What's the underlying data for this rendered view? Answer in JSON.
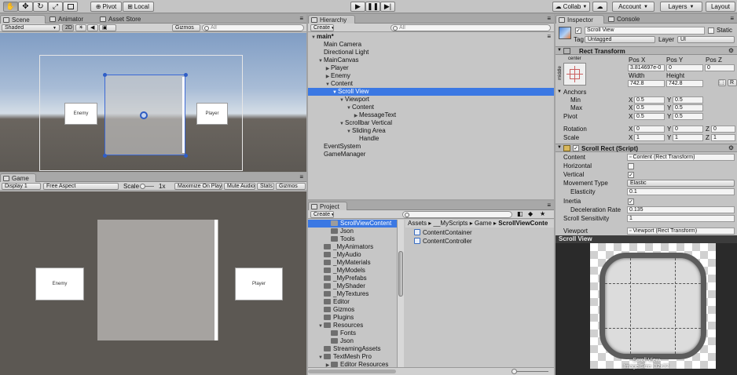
{
  "toolbar": {
    "pivot_label": "Pivot",
    "local_label": "Local",
    "collab_label": "Collab",
    "account_label": "Account",
    "layers_label": "Layers",
    "layout_label": "Layout"
  },
  "scene": {
    "tabs": [
      "Scene",
      "Animator",
      "Asset Store"
    ],
    "shading_label": "Shaded",
    "mode_2d_label": "2D",
    "gizmos_label": "Gizmos",
    "search_placeholder": "All",
    "card_left": "Enemy",
    "card_right": "Player"
  },
  "game": {
    "tab_label": "Game",
    "display_label": "Display 1",
    "aspect_label": "Free Aspect",
    "scale_label": "Scale",
    "scale_value": "1x",
    "maximize_label": "Maximize On Play",
    "mute_label": "Mute Audio",
    "stats_label": "Stats",
    "gizmos_label": "Gizmos",
    "card_left": "Enemy",
    "card_right": "Player"
  },
  "hierarchy": {
    "tab_label": "Hierarchy",
    "create_label": "Create",
    "search_placeholder": "All",
    "items": [
      {
        "label": "main*",
        "depth": 0,
        "expander": "down",
        "selected": false
      },
      {
        "label": "Main Camera",
        "depth": 1,
        "expander": "",
        "selected": false
      },
      {
        "label": "Directional Light",
        "depth": 1,
        "expander": "",
        "selected": false
      },
      {
        "label": "MainCanvas",
        "depth": 1,
        "expander": "down",
        "selected": false
      },
      {
        "label": "Player",
        "depth": 2,
        "expander": "right",
        "selected": false
      },
      {
        "label": "Enemy",
        "depth": 2,
        "expander": "right",
        "selected": false
      },
      {
        "label": "Content",
        "depth": 2,
        "expander": "down",
        "selected": false
      },
      {
        "label": "Scroll View",
        "depth": 3,
        "expander": "down",
        "selected": true
      },
      {
        "label": "Viewport",
        "depth": 4,
        "expander": "down",
        "selected": false
      },
      {
        "label": "Content",
        "depth": 5,
        "expander": "down",
        "selected": false
      },
      {
        "label": "MessageText",
        "depth": 6,
        "expander": "right",
        "selected": false
      },
      {
        "label": "Scrollbar Vertical",
        "depth": 4,
        "expander": "down",
        "selected": false
      },
      {
        "label": "Sliding Area",
        "depth": 5,
        "expander": "down",
        "selected": false
      },
      {
        "label": "Handle",
        "depth": 6,
        "expander": "",
        "selected": false
      },
      {
        "label": "EventSystem",
        "depth": 1,
        "expander": "",
        "selected": false
      },
      {
        "label": "GameManager",
        "depth": 1,
        "expander": "",
        "selected": false
      }
    ]
  },
  "project": {
    "tab_label": "Project",
    "create_label": "Create",
    "breadcrumb": [
      "Assets",
      "__MyScripts",
      "Game",
      "ScrollViewConte"
    ],
    "tree": [
      {
        "label": "ScrollViewContent",
        "depth": 2,
        "expander": "",
        "selected": true
      },
      {
        "label": "Json",
        "depth": 2,
        "expander": "",
        "selected": false
      },
      {
        "label": "Tools",
        "depth": 2,
        "expander": "",
        "selected": false
      },
      {
        "label": "_MyAnimators",
        "depth": 1,
        "expander": "",
        "selected": false
      },
      {
        "label": "_MyAudio",
        "depth": 1,
        "expander": "",
        "selected": false
      },
      {
        "label": "_MyMaterials",
        "depth": 1,
        "expander": "",
        "selected": false
      },
      {
        "label": "_MyModels",
        "depth": 1,
        "expander": "",
        "selected": false
      },
      {
        "label": "_MyPrefabs",
        "depth": 1,
        "expander": "",
        "selected": false
      },
      {
        "label": "_MyShader",
        "depth": 1,
        "expander": "",
        "selected": false
      },
      {
        "label": "_MyTextures",
        "depth": 1,
        "expander": "",
        "selected": false
      },
      {
        "label": "Editor",
        "depth": 1,
        "expander": "",
        "selected": false
      },
      {
        "label": "Gizmos",
        "depth": 1,
        "expander": "",
        "selected": false
      },
      {
        "label": "Plugins",
        "depth": 1,
        "expander": "",
        "selected": false
      },
      {
        "label": "Resources",
        "depth": 1,
        "expander": "down",
        "selected": false
      },
      {
        "label": "Fonts",
        "depth": 2,
        "expander": "",
        "selected": false
      },
      {
        "label": "Json",
        "depth": 2,
        "expander": "",
        "selected": false
      },
      {
        "label": "StreamingAssets",
        "depth": 1,
        "expander": "",
        "selected": false
      },
      {
        "label": "TextMesh Pro",
        "depth": 1,
        "expander": "down",
        "selected": false
      },
      {
        "label": "Editor Resources",
        "depth": 2,
        "expander": "right",
        "selected": false
      }
    ],
    "files": [
      "ContentContainer",
      "ContentController"
    ]
  },
  "inspector": {
    "tabs": [
      "Inspector",
      "Console"
    ],
    "object_name": "Scroll View",
    "static_label": "Static",
    "tag_label": "Tag",
    "tag_value": "Untagged",
    "layer_label": "Layer",
    "layer_value": "UI",
    "rect_transform": {
      "title": "Rect Transform",
      "anchor_h": "center",
      "anchor_v": "middle",
      "pos_x_label": "Pos X",
      "pos_y_label": "Pos Y",
      "pos_z_label": "Pos Z",
      "pos_x": "3.814697e-0",
      "pos_y": "0",
      "pos_z": "0",
      "width_label": "Width",
      "height_label": "Height",
      "width": "742.8",
      "height": "742.8",
      "r_label": "R",
      "anchors_label": "Anchors",
      "min_label": "Min",
      "max_label": "Max",
      "pivot_label": "Pivot",
      "min_x": "0.5",
      "min_y": "0.5",
      "max_x": "0.5",
      "max_y": "0.5",
      "pivot_x": "0.5",
      "pivot_y": "0.5",
      "rotation_label": "Rotation",
      "rotation_x": "0",
      "rotation_y": "0",
      "rotation_z": "0",
      "scale_label": "Scale",
      "scale_x": "1",
      "scale_y": "1",
      "scale_z": "1",
      "x_axis": "X",
      "y_axis": "Y",
      "z_axis": "Z"
    },
    "scroll_rect": {
      "title": "Scroll Rect (Script)",
      "content_label": "Content",
      "content_value": "Content (Rect Transform)",
      "horizontal_label": "Horizontal",
      "horizontal_checked": false,
      "vertical_label": "Vertical",
      "vertical_checked": true,
      "movement_label": "Movement Type",
      "movement_value": "Elastic",
      "elasticity_label": "Elasticity",
      "elasticity_value": "0.1",
      "inertia_label": "Inertia",
      "inertia_checked": true,
      "decel_label": "Deceleration Rate",
      "decel_value": "0.135",
      "sensitivity_label": "Scroll Sensitivity",
      "sensitivity_value": "1",
      "viewport_label": "Viewport",
      "viewport_value": "Viewport (Rect Transform)"
    },
    "preview": {
      "title": "Scroll View",
      "caption_name": "Scroll View",
      "caption_size": "Image Size: 32x32"
    }
  },
  "colors": {
    "selection": "#3b78e3",
    "sky_top": "#7a9bc6",
    "ground": "#5b5752"
  }
}
